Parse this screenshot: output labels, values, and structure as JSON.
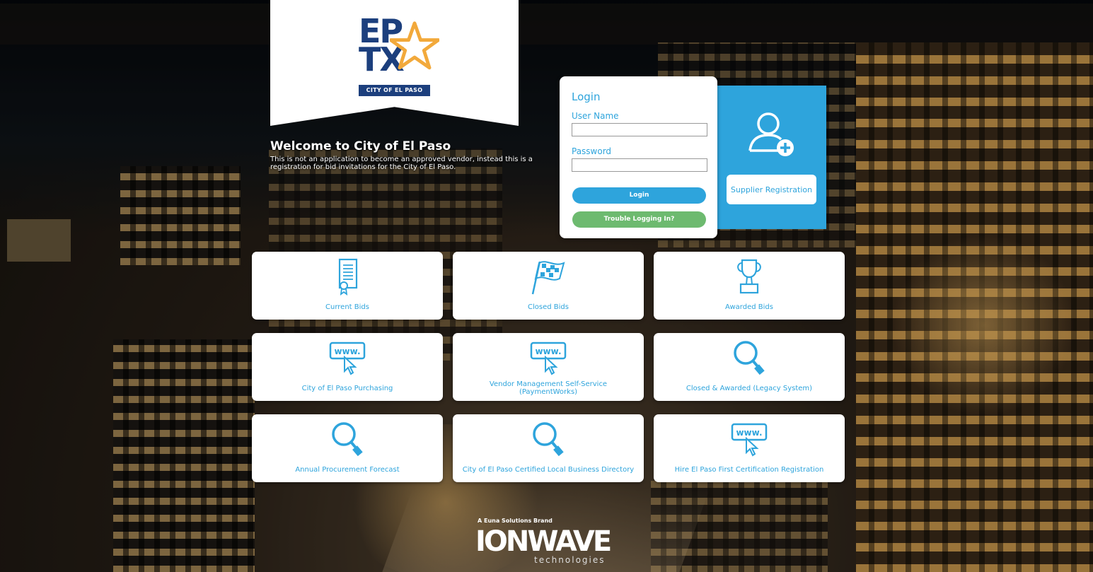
{
  "logo": {
    "line1": "EP",
    "line2": "TX",
    "tagline": "CITY OF EL PASO"
  },
  "welcome": {
    "title": "Welcome to City of El Paso",
    "text": "This is not an application to become an approved vendor, instead this is a registration for bid invitations for the City of El Paso."
  },
  "login": {
    "title": "Login",
    "username_label": "User Name",
    "username_value": "",
    "password_label": "Password",
    "password_value": "",
    "login_button": "Login",
    "trouble_button": "Trouble Logging In?"
  },
  "supplier": {
    "button_label": "Supplier Registration",
    "icon": "user-add-icon"
  },
  "tiles": [
    {
      "label": "Current Bids",
      "icon": "document-certificate-icon"
    },
    {
      "label": "Closed Bids",
      "icon": "checkered-flag-icon"
    },
    {
      "label": "Awarded Bids",
      "icon": "trophy-icon"
    },
    {
      "label": "City of El Paso Purchasing",
      "icon": "www-cursor-icon"
    },
    {
      "label": "Vendor Management Self-Service (PaymentWorks)",
      "icon": "www-cursor-icon"
    },
    {
      "label": "Closed & Awarded (Legacy System)",
      "icon": "magnifier-icon"
    },
    {
      "label": "Annual Procurement Forecast",
      "icon": "magnifier-icon"
    },
    {
      "label": "City of El Paso Certified Local Business Directory",
      "icon": "magnifier-icon"
    },
    {
      "label": "Hire El Paso First Certification Registration",
      "icon": "www-cursor-icon"
    }
  ],
  "brand": {
    "tagline": "A Euna Solutions Brand",
    "name": "IONWAVE",
    "sub": "technologies"
  },
  "colors": {
    "accent": "#2ea4dc",
    "green": "#6dba6f",
    "logo_blue": "#1c3f7d",
    "logo_gold": "#f2a93b"
  }
}
